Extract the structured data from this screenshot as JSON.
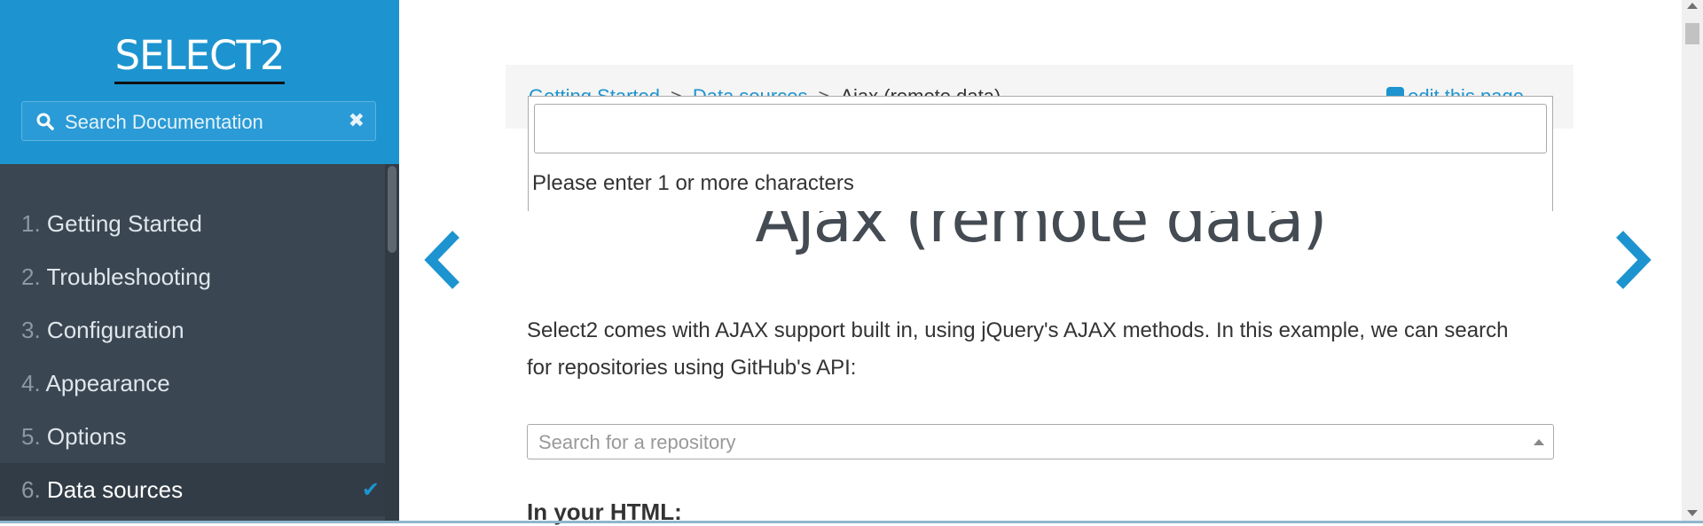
{
  "sidebar": {
    "logo": "SELECT2",
    "search": {
      "placeholder": "Search Documentation",
      "value": "",
      "clear_icon": "times-icon"
    },
    "items": [
      {
        "num": "1.",
        "label": "Getting Started"
      },
      {
        "num": "2.",
        "label": "Troubleshooting"
      },
      {
        "num": "3.",
        "label": "Configuration"
      },
      {
        "num": "4.",
        "label": "Appearance"
      },
      {
        "num": "5.",
        "label": "Options"
      },
      {
        "num": "6.",
        "label": "Data sources",
        "active": true,
        "icon": "check-icon"
      }
    ]
  },
  "main": {
    "breadcrumb": {
      "items": [
        "Getting Started",
        "Data sources"
      ],
      "current": "Ajax (remote data)",
      "separator": ">"
    },
    "edit_link": "edit this page",
    "title": "Ajax (remote data)",
    "intro": "Select2 comes with AJAX support built in, using jQuery's AJAX methods. In this example, we can search for repositories using GitHub's API:",
    "select_placeholder": "Search for a repository",
    "html_heading": "In your HTML:",
    "dropdown": {
      "search_value": "",
      "message": "Please enter 1 or more characters"
    }
  },
  "colors": {
    "accent": "#1d94cf",
    "sidebar_bg": "#3a4651",
    "text": "#333333"
  }
}
